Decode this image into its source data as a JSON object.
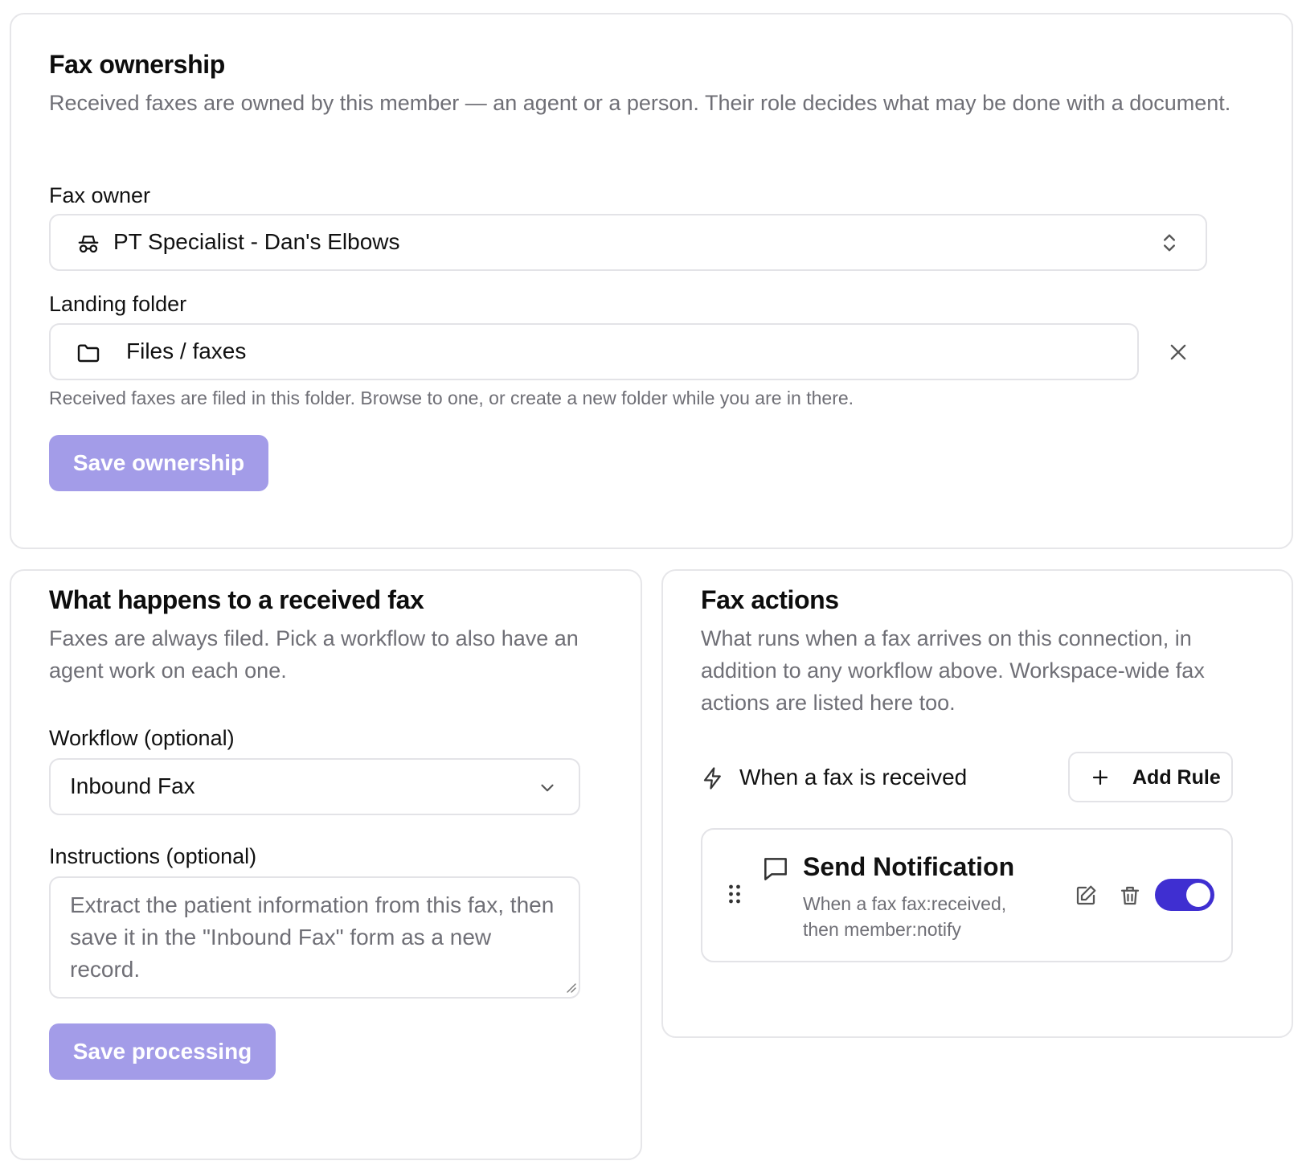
{
  "ownership": {
    "title": "Fax ownership",
    "description": "Received faxes are owned by this member — an agent or a person. Their role decides what may be done with a document.",
    "owner_label": "Fax owner",
    "owner_value": "PT Specialist - Dan's Elbows",
    "folder_label": "Landing folder",
    "folder_value": "Files / faxes",
    "folder_hint": "Received faxes are filed in this folder. Browse to one, or create a new folder while you are in there.",
    "save_label": "Save ownership"
  },
  "processing": {
    "title": "What happens to a received fax",
    "description": "Faxes are always filed. Pick a workflow to also have an agent work on each one.",
    "workflow_label": "Workflow (optional)",
    "workflow_value": "Inbound Fax",
    "instructions_label": "Instructions (optional)",
    "instructions_value": "Extract the patient information from this fax, then save it in the \"Inbound Fax\" form as a new record.",
    "save_label": "Save processing"
  },
  "actions": {
    "title": "Fax actions",
    "description": "What runs when a fax arrives on this connection, in addition to any workflow above. Workspace-wide fax actions are listed here too.",
    "trigger_label": "When a fax is received",
    "add_rule_label": "Add Rule",
    "rule": {
      "title": "Send Notification",
      "summary_line1": "When a fax fax:received,",
      "summary_line2": "then member:notify",
      "enabled": true
    }
  },
  "colors": {
    "primary_disabled": "#a39ce8",
    "toggle_on": "#3f2fd1",
    "border": "#e3e3e7",
    "muted_text": "#6f6f76"
  },
  "icons": {
    "owner": "agent-glasses-icon",
    "owner_select": "chevron-up-down-icon",
    "folder": "folder-icon",
    "clear": "close-icon",
    "workflow_select": "chevron-down-icon",
    "trigger": "lightning-icon",
    "add": "plus-icon",
    "drag": "drag-handle-icon",
    "rule": "message-icon",
    "edit": "edit-icon",
    "delete": "trash-icon"
  }
}
